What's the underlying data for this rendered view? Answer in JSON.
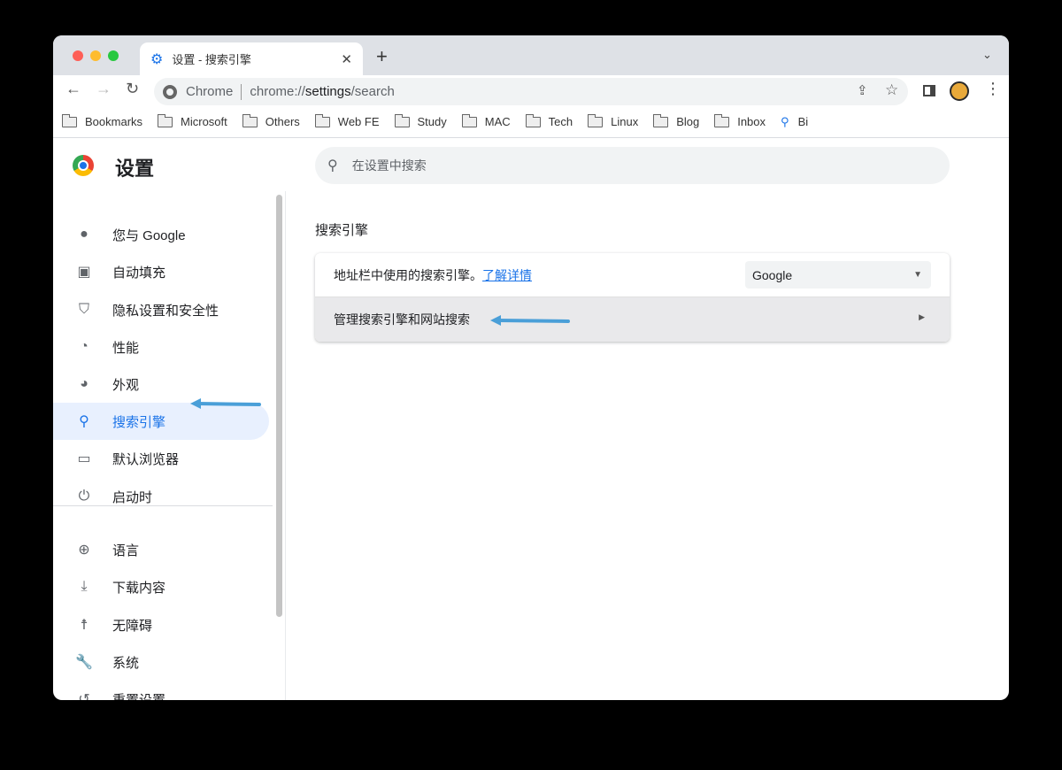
{
  "tab": {
    "title": "设置 - 搜索引擎",
    "icon": "gear-icon"
  },
  "omnibox": {
    "site_label": "Chrome",
    "url_prefix": "chrome://",
    "url_host": "settings",
    "url_path": "/search"
  },
  "bookmarks": [
    {
      "label": "Bookmarks"
    },
    {
      "label": "Microsoft"
    },
    {
      "label": "Others"
    },
    {
      "label": "Web FE"
    },
    {
      "label": "Study"
    },
    {
      "label": "MAC"
    },
    {
      "label": "Tech"
    },
    {
      "label": "Linux"
    },
    {
      "label": "Blog"
    },
    {
      "label": "Inbox"
    }
  ],
  "bookmark_search": {
    "label": "Bi"
  },
  "settings": {
    "title": "设置",
    "search_placeholder": "在设置中搜索"
  },
  "sidebar": {
    "items": [
      {
        "label": "您与 Google",
        "icon": "person-icon"
      },
      {
        "label": "自动填充",
        "icon": "clipboard-icon"
      },
      {
        "label": "隐私设置和安全性",
        "icon": "shield-icon"
      },
      {
        "label": "性能",
        "icon": "speedometer-icon"
      },
      {
        "label": "外观",
        "icon": "palette-icon"
      },
      {
        "label": "搜索引擎",
        "icon": "search-icon",
        "active": true
      },
      {
        "label": "默认浏览器",
        "icon": "browser-icon"
      },
      {
        "label": "启动时",
        "icon": "power-icon"
      },
      {
        "label": "语言",
        "icon": "globe-icon"
      },
      {
        "label": "下载内容",
        "icon": "download-icon"
      },
      {
        "label": "无障碍",
        "icon": "accessibility-icon"
      },
      {
        "label": "系统",
        "icon": "wrench-icon"
      },
      {
        "label": "重置设置",
        "icon": "history-icon"
      }
    ]
  },
  "main": {
    "section_title": "搜索引擎",
    "engine_row_label": "地址栏中使用的搜索引擎。",
    "learn_more": "了解详情",
    "engine_value": "Google",
    "manage_label": "管理搜索引擎和网站搜索"
  },
  "colors": {
    "accent": "#1a73e8",
    "annotation_arrow": "#4a9fd8"
  }
}
